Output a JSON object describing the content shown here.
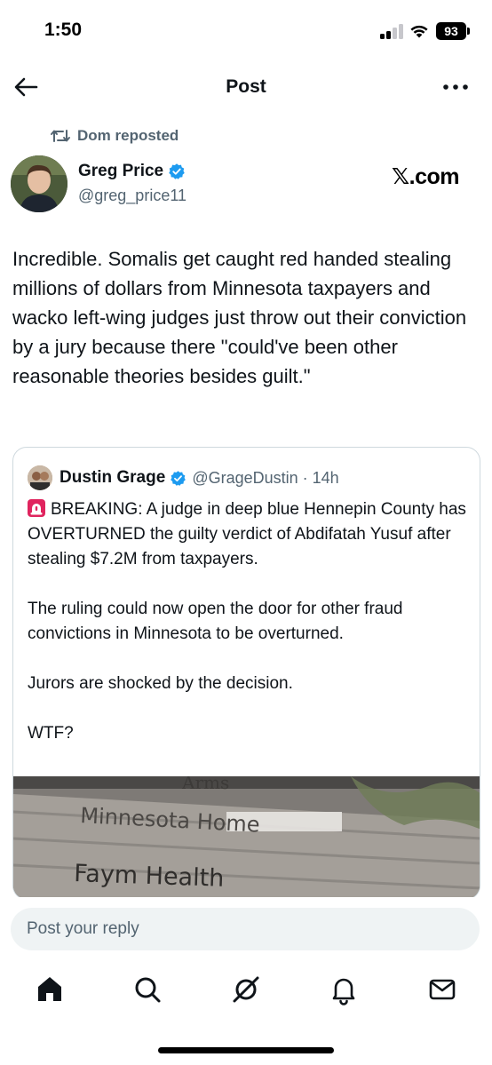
{
  "status_bar": {
    "time": "1:50",
    "battery": "93"
  },
  "header": {
    "title": "Post"
  },
  "repost": {
    "text": "Dom reposted"
  },
  "author": {
    "name": "Greg Price",
    "handle": "@greg_price11",
    "source": "𝕏.com"
  },
  "tweet": {
    "text": "Incredible. Somalis get caught red handed stealing millions of dollars from Minnesota taxpayers and wacko left-wing judges just throw out their conviction by a jury because there \"could've been other reasonable theories besides guilt.\""
  },
  "quote": {
    "name": "Dustin Grage",
    "handle": "@GrageDustin · 14h",
    "paragraphs": [
      "BREAKING: A judge in deep blue Hennepin County has OVERTURNED the guilty verdict of Abdifatah Yusuf after stealing $7.2M from taxpayers.",
      "The ruling could now open the door for other fraud convictions in Minnesota to be overturned.",
      "Jurors are shocked by the decision.",
      "WTF?"
    ],
    "media_sign": {
      "line1": "Minnesota Home",
      "line2": "Faym Health",
      "top_partial": "Arms"
    }
  },
  "reply": {
    "placeholder": "Post your reply"
  },
  "tabs": [
    "home-icon",
    "search-icon",
    "grok-icon",
    "notifications-icon",
    "messages-icon"
  ],
  "colors": {
    "verified": "#1d9bf0",
    "secondary_text": "#536471",
    "border": "#cfd9de"
  }
}
